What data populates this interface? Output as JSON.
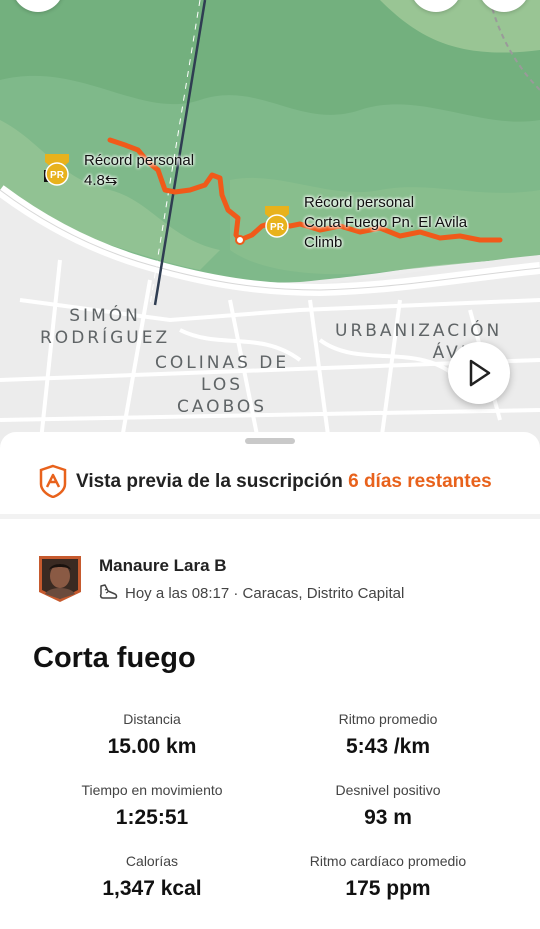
{
  "map": {
    "neighborhoods": {
      "simon_rodriguez": [
        "SIMÓN",
        "RODRÍGUEZ"
      ],
      "colinas": [
        "COLINAS DE",
        "LOS",
        "CAOBOS"
      ],
      "urbanizacion": [
        "URBANIZACIÓN",
        "ÁVILA"
      ]
    },
    "pr_left": {
      "label": "Récord personal",
      "value": "4.8⇆",
      "badge": "PR"
    },
    "pr_right": {
      "label": "Récord personal",
      "segment_line1": "Corta Fuego Pn. El Avila",
      "segment_line2": "Climb",
      "badge": "PR"
    },
    "play_icon": "play-icon",
    "route_color": "#f05a1a"
  },
  "subscription": {
    "text": "Vista previa de la suscripción",
    "days": "6 días restantes",
    "icon": "strava-shield-icon"
  },
  "activity": {
    "athlete": "Manaure Lara B",
    "meta": "Hoy a las 08:17 · Caracas, Distrito Capital",
    "sport_icon": "shoe-icon",
    "title": "Corta fuego"
  },
  "stats": [
    {
      "label": "Distancia",
      "value": "15.00 km"
    },
    {
      "label": "Ritmo promedio",
      "value": "5:43 /km"
    },
    {
      "label": "Tiempo en movimiento",
      "value": "1:25:51"
    },
    {
      "label": "Desnivel positivo",
      "value": "93 m"
    },
    {
      "label": "Calorías",
      "value": "1,347 kcal"
    },
    {
      "label": "Ritmo cardíaco promedio",
      "value": "175 ppm"
    }
  ]
}
